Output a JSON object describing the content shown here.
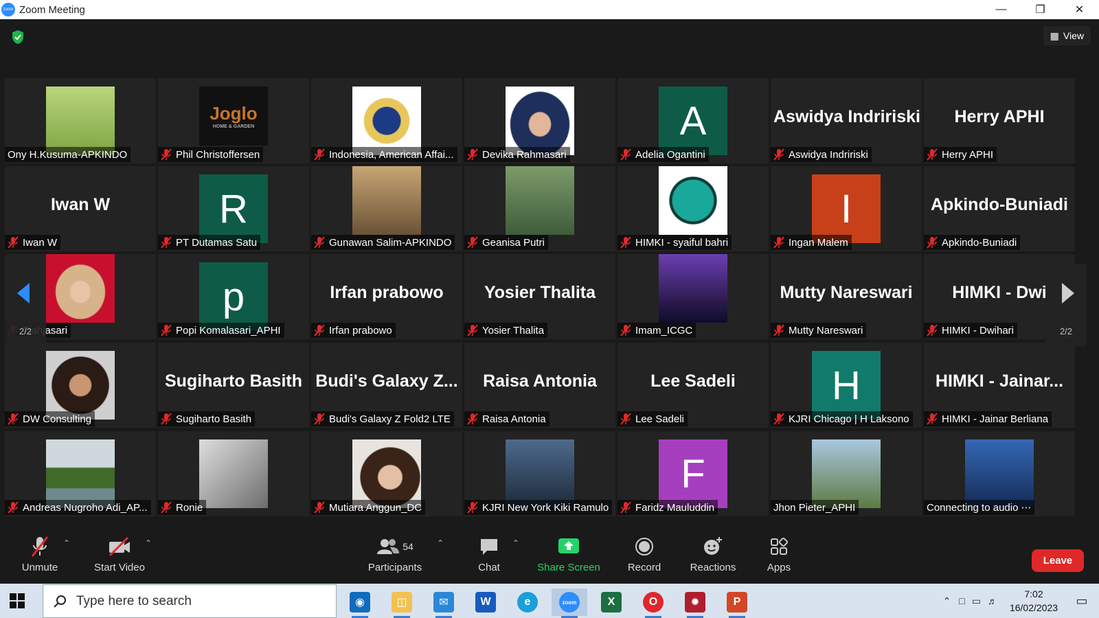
{
  "window": {
    "title": "Zoom Meeting",
    "view_label": "View"
  },
  "pagination": {
    "left": "2/2",
    "right": "2/2"
  },
  "participants": [
    {
      "name": "Ony H.Kusuma-APKINDO",
      "muted": false,
      "kind": "photo",
      "photo": "man-glasses-bamboo"
    },
    {
      "name": "Phil Christoffersen",
      "muted": true,
      "kind": "logo",
      "logo_text": "Joglo",
      "logo_sub": "HOME & GARDEN"
    },
    {
      "name": "Indonesia, American Affai...",
      "muted": true,
      "kind": "photo",
      "photo": "embassy-emblem"
    },
    {
      "name": "Devika Rahmasari",
      "muted": true,
      "kind": "photo",
      "photo": "woman-hijab-navy"
    },
    {
      "name": "Adelia Ogantini",
      "muted": true,
      "kind": "letter",
      "letter": "A",
      "color": "#0e5c47"
    },
    {
      "name": "Aswidya Indririski",
      "muted": true,
      "kind": "text",
      "big": "Aswidya Indririski"
    },
    {
      "name": "Herry APHI",
      "muted": true,
      "kind": "text",
      "big": "Herry APHI"
    },
    {
      "name": "Iwan W",
      "muted": true,
      "kind": "text",
      "big": "Iwan W"
    },
    {
      "name": "PT Dutamas Satu",
      "muted": true,
      "kind": "letter",
      "letter": "R",
      "color": "#0e5c47"
    },
    {
      "name": "Gunawan Salim-APKINDO",
      "muted": true,
      "kind": "photo",
      "photo": "man-office"
    },
    {
      "name": "Geanisa Putri",
      "muted": true,
      "kind": "photo",
      "photo": "garden-arch"
    },
    {
      "name": "HIMKI - syaiful bahri",
      "muted": true,
      "kind": "photo",
      "photo": "himki-logo"
    },
    {
      "name": "Ingan Malem",
      "muted": true,
      "kind": "letter",
      "letter": "I",
      "color": "#c8401a"
    },
    {
      "name": "Apkindo-Buniadi",
      "muted": true,
      "kind": "text",
      "big": "Apkindo-Buniadi"
    },
    {
      "name": "Tjahjasari",
      "muted": true,
      "kind": "photo",
      "photo": "woman-hijab-red"
    },
    {
      "name": "Popi Komalasari_APHI",
      "muted": true,
      "kind": "letter",
      "letter": "p",
      "color": "#0e5c47"
    },
    {
      "name": "Irfan prabowo",
      "muted": true,
      "kind": "text",
      "big": "Irfan prabowo"
    },
    {
      "name": "Yosier Thalita",
      "muted": true,
      "kind": "text",
      "big": "Yosier Thalita"
    },
    {
      "name": "Imam_ICGC",
      "muted": true,
      "kind": "photo",
      "photo": "city-night"
    },
    {
      "name": "Mutty Nareswari",
      "muted": true,
      "kind": "text",
      "big": "Mutty Nareswari"
    },
    {
      "name": "HIMKI - Dwihari",
      "muted": true,
      "kind": "text",
      "big": "HIMKI - Dwi"
    },
    {
      "name": "DW Consulting",
      "muted": true,
      "kind": "photo",
      "photo": "woman-portrait"
    },
    {
      "name": "Sugiharto Basith",
      "muted": true,
      "kind": "text",
      "big": "Sugiharto Basith"
    },
    {
      "name": "Budi's Galaxy Z Fold2 LTE",
      "muted": true,
      "kind": "text",
      "big": "Budi's Galaxy Z..."
    },
    {
      "name": "Raisa Antonia",
      "muted": true,
      "kind": "text",
      "big": "Raisa Antonia"
    },
    {
      "name": "Lee Sadeli",
      "muted": true,
      "kind": "text",
      "big": "Lee Sadeli"
    },
    {
      "name": "KJRI Chicago | H Laksono",
      "muted": true,
      "kind": "letter",
      "letter": "H",
      "color": "#127a6a"
    },
    {
      "name": "HIMKI - Jainar Berliana",
      "muted": true,
      "kind": "text",
      "big": "HIMKI - Jainar..."
    },
    {
      "name": "Andreas Nugroho Adi_AP...",
      "muted": true,
      "kind": "photo",
      "photo": "mangrove"
    },
    {
      "name": "Ronie",
      "muted": true,
      "kind": "photo",
      "photo": "person-hoodie"
    },
    {
      "name": "Mutiara Anggun_DC",
      "muted": true,
      "kind": "photo",
      "photo": "woman-smiling"
    },
    {
      "name": "KJRI New York Kiki Ramulo",
      "muted": true,
      "kind": "photo",
      "photo": "man-suit"
    },
    {
      "name": "Faridz Mauluddin",
      "muted": true,
      "kind": "letter",
      "letter": "F",
      "color": "#a63fbf"
    },
    {
      "name": "Jhon Pieter_APHI",
      "muted": false,
      "kind": "photo",
      "photo": "man-helmet",
      "mic_on": true
    },
    {
      "name": "Connecting to audio",
      "muted": false,
      "kind": "photo",
      "photo": "drone-controller",
      "connecting": true
    }
  ],
  "toolbar": {
    "unmute": "Unmute",
    "start_video": "Start Video",
    "participants": "Participants",
    "participant_count": "54",
    "chat": "Chat",
    "share_screen": "Share Screen",
    "record": "Record",
    "reactions": "Reactions",
    "apps": "Apps",
    "leave": "Leave"
  },
  "taskbar": {
    "search_placeholder": "Type here to search",
    "time": "7:02",
    "date": "16/02/2023",
    "apps": [
      "outlook-app",
      "file-explorer",
      "mail-app",
      "word-app",
      "edge-browser",
      "zoom-app",
      "excel-app",
      "opera-browser",
      "game-app",
      "powerpoint-app"
    ]
  },
  "colors": {
    "leave": "#e02828",
    "share_green": "#24d366",
    "zoom_blue": "#2d8cff",
    "mute_red": "#e02828"
  }
}
